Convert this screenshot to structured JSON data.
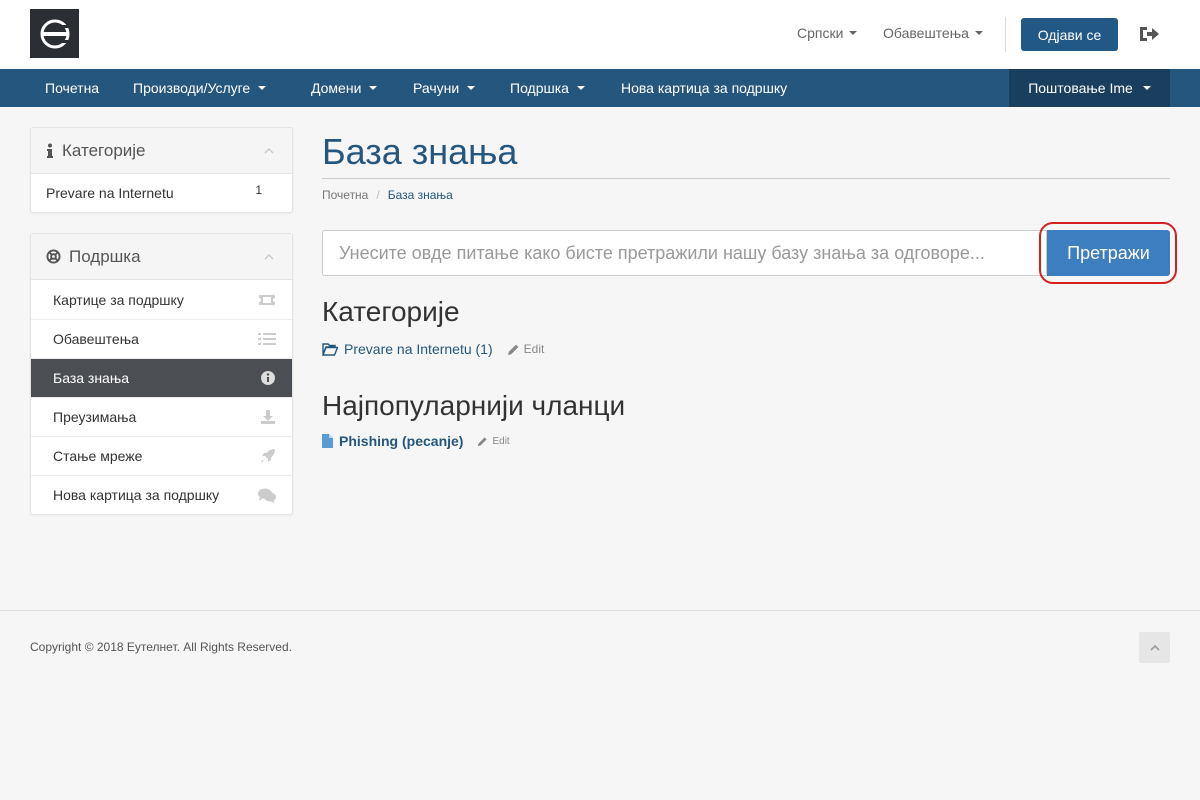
{
  "header": {
    "logo_icon": "brand-logo-icon",
    "language": "Српски",
    "notifications": "Обавештења",
    "logout_label": "Одјави се",
    "exit_icon": "sign-out-icon"
  },
  "navbar": {
    "items": [
      {
        "label": "Почетна",
        "dropdown": false
      },
      {
        "label": "Производи/Услуге",
        "dropdown": true
      },
      {
        "label": "Домени",
        "dropdown": true
      },
      {
        "label": "Рачуни",
        "dropdown": true
      },
      {
        "label": "Подршка",
        "dropdown": true
      },
      {
        "label": "Нова картица за подршку",
        "dropdown": false
      }
    ],
    "account_label": "Поштовање Ime"
  },
  "sidebar": {
    "categories": {
      "title": "Категорије",
      "icon": "info-icon",
      "items": [
        {
          "label": "Prevare na Internetu",
          "count": "1"
        }
      ]
    },
    "support": {
      "title": "Подршка",
      "icon": "life-ring-icon",
      "items": [
        {
          "label": "Картице за подршку",
          "icon": "ticket-icon",
          "active": false
        },
        {
          "label": "Обавештења",
          "icon": "list-icon",
          "active": false
        },
        {
          "label": "База знања",
          "icon": "info-circle-icon",
          "active": true
        },
        {
          "label": "Преузимања",
          "icon": "download-icon",
          "active": false
        },
        {
          "label": "Стање мреже",
          "icon": "rocket-icon",
          "active": false
        },
        {
          "label": "Нова картица за подршку",
          "icon": "comments-icon",
          "active": false
        }
      ]
    }
  },
  "main": {
    "title": "База знања",
    "breadcrumb": [
      "Почетна",
      "База знања"
    ],
    "search": {
      "placeholder": "Унесите овде питање како бисте претражили нашу базу знања за одговоре...",
      "button_label": "Претражи"
    },
    "categories_heading": "Категорије",
    "category_link": "Prevare na Internetu (1)",
    "edit_label": "Edit",
    "popular_heading": "Најпопуларнији чланци",
    "article_link": "Phishing (pecanje)"
  },
  "footer": {
    "copyright": "Copyright © 2018 Еутелнет. All Rights Reserved."
  },
  "colors": {
    "brand": "#25567e",
    "accent": "#3d7ec0",
    "highlight": "#d62020"
  }
}
